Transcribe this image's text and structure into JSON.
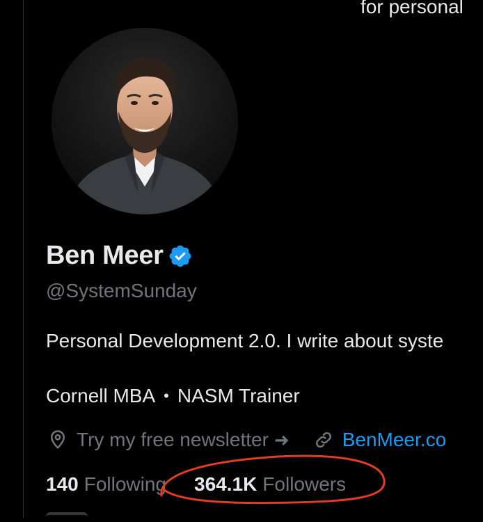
{
  "header": {
    "partial_text": "for personal"
  },
  "profile": {
    "display_name": "Ben Meer",
    "verified": true,
    "handle": "@SystemSunday",
    "bio": "Personal Development 2.0. I write about syste",
    "credentials": [
      "Cornell MBA",
      "NASM Trainer"
    ],
    "credentials_separator": "•",
    "location": "Try my free newsletter",
    "location_arrow": "➜",
    "website": "BenMeer.co"
  },
  "stats": {
    "following_count": "140",
    "following_label": "Following",
    "followers_count": "364.1K",
    "followers_label": "Followers"
  },
  "icons": {
    "verified": "verified-badge-icon",
    "location": "location-pin-icon",
    "link": "link-icon"
  },
  "colors": {
    "background": "#000000",
    "text_primary": "#e7e9ea",
    "text_secondary": "#71767b",
    "accent_blue": "#1d9bf0",
    "annotation_red": "#e0401f"
  }
}
